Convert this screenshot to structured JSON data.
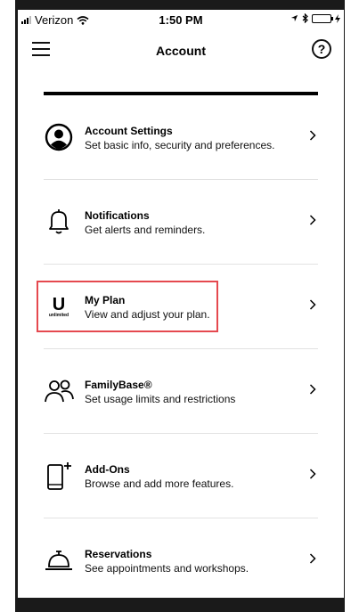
{
  "status_bar": {
    "carrier": "Verizon",
    "time": "1:50 PM"
  },
  "header": {
    "menu_icon": "hamburger-menu-icon",
    "title": "Account",
    "help_icon": "help-circle-icon",
    "help_label": "?"
  },
  "menu": {
    "items": [
      {
        "icon": "account-circle-icon",
        "title": "Account Settings",
        "subtitle": "Set basic info, security and preferences."
      },
      {
        "icon": "bell-icon",
        "title": "Notifications",
        "subtitle": "Get alerts and reminders."
      },
      {
        "icon": "unlimited-plan-icon",
        "icon_text": "U",
        "icon_subtext": "unlimited",
        "title": "My Plan",
        "subtitle": "View and adjust your plan.",
        "highlighted": true
      },
      {
        "icon": "people-icon",
        "title": "FamilyBase®",
        "subtitle": "Set usage limits and restrictions"
      },
      {
        "icon": "phone-plus-icon",
        "title": "Add-Ons",
        "subtitle": "Browse and add more features."
      },
      {
        "icon": "service-bell-icon",
        "title": "Reservations",
        "subtitle": "See appointments and workshops."
      }
    ],
    "chevron_icon": "chevron-right-icon"
  },
  "colors": {
    "highlight_border": "#e5494f",
    "battery_fill": "#1fc51f"
  }
}
